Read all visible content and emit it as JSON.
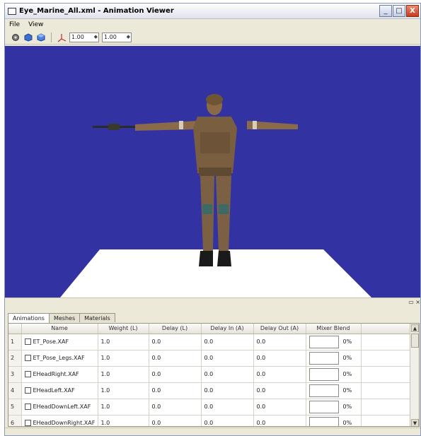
{
  "window": {
    "title": "Eye_Marine_All.xml - Animation Viewer",
    "buttons": [
      "_",
      "□",
      "X"
    ]
  },
  "menu": {
    "items": [
      "File",
      "View"
    ]
  },
  "toolbar": {
    "icons": [
      "wireframe-icon",
      "solid-shaded-icon",
      "textured-icon",
      "axis-icon"
    ],
    "spin1_value": "1.00",
    "spin2_value": "1.00"
  },
  "colors": {
    "viewport_bg": "#3232a2",
    "floor": "#ffffff"
  },
  "tabs": [
    "Animations",
    "Meshes",
    "Materials"
  ],
  "table": {
    "columns": [
      "",
      "Name",
      "Weight (L)",
      "Delay (L)",
      "Delay In (A)",
      "Delay Out (A)",
      "Mixer Blend"
    ],
    "rows": [
      {
        "num": "1",
        "name": "ET_Pose.XAF",
        "weight": "1.0",
        "delay": "0.0",
        "delay_in": "0.0",
        "delay_out": "0.0",
        "blend": "0%"
      },
      {
        "num": "2",
        "name": "ET_Pose_Legs.XAF",
        "weight": "1.0",
        "delay": "0.0",
        "delay_in": "0.0",
        "delay_out": "0.0",
        "blend": "0%"
      },
      {
        "num": "3",
        "name": "EHeadRight.XAF",
        "weight": "1.0",
        "delay": "0.0",
        "delay_in": "0.0",
        "delay_out": "0.0",
        "blend": "0%"
      },
      {
        "num": "4",
        "name": "EHeadLeft.XAF",
        "weight": "1.0",
        "delay": "0.0",
        "delay_in": "0.0",
        "delay_out": "0.0",
        "blend": "0%"
      },
      {
        "num": "5",
        "name": "EHeadDownLeft.XAF",
        "weight": "1.0",
        "delay": "0.0",
        "delay_in": "0.0",
        "delay_out": "0.0",
        "blend": "0%"
      },
      {
        "num": "6",
        "name": "EHeadDownRight.XAF",
        "weight": "1.0",
        "delay": "0.0",
        "delay_in": "0.0",
        "delay_out": "0.0",
        "blend": "0%"
      }
    ]
  }
}
